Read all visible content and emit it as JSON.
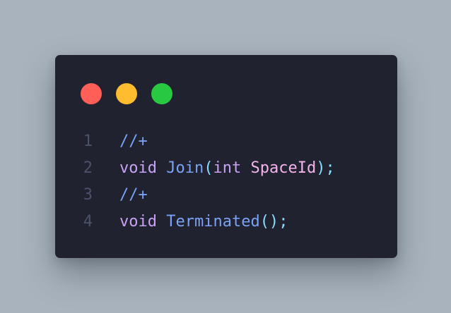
{
  "colors": {
    "background": "#a9b3bd",
    "window": "#20222f",
    "line_number": "#4b526a",
    "comment": "#7aa2f7",
    "keyword": "#c9a2f5",
    "function": "#7aa2f7",
    "paren": "#89ddff",
    "type": "#c9a2f5",
    "param": "#f5b3ec",
    "punct": "#89ddff"
  },
  "window_controls": [
    {
      "name": "close",
      "color": "#ff5f57"
    },
    {
      "name": "minimize",
      "color": "#febc2e"
    },
    {
      "name": "maximize",
      "color": "#28c840"
    }
  ],
  "code": {
    "lines": [
      {
        "number": "1",
        "tokens": [
          {
            "text": "//+",
            "kind": "comment"
          }
        ]
      },
      {
        "number": "2",
        "tokens": [
          {
            "text": "void",
            "kind": "keyword"
          },
          {
            "text": " ",
            "kind": "plain"
          },
          {
            "text": "Join",
            "kind": "function"
          },
          {
            "text": "(",
            "kind": "paren"
          },
          {
            "text": "int",
            "kind": "type"
          },
          {
            "text": " ",
            "kind": "plain"
          },
          {
            "text": "SpaceId",
            "kind": "param"
          },
          {
            "text": ")",
            "kind": "paren"
          },
          {
            "text": ";",
            "kind": "punct"
          }
        ]
      },
      {
        "number": "3",
        "tokens": [
          {
            "text": "//+",
            "kind": "comment"
          }
        ]
      },
      {
        "number": "4",
        "tokens": [
          {
            "text": "void",
            "kind": "keyword"
          },
          {
            "text": " ",
            "kind": "plain"
          },
          {
            "text": "Terminated",
            "kind": "function"
          },
          {
            "text": "()",
            "kind": "paren"
          },
          {
            "text": ";",
            "kind": "punct"
          }
        ]
      }
    ]
  }
}
